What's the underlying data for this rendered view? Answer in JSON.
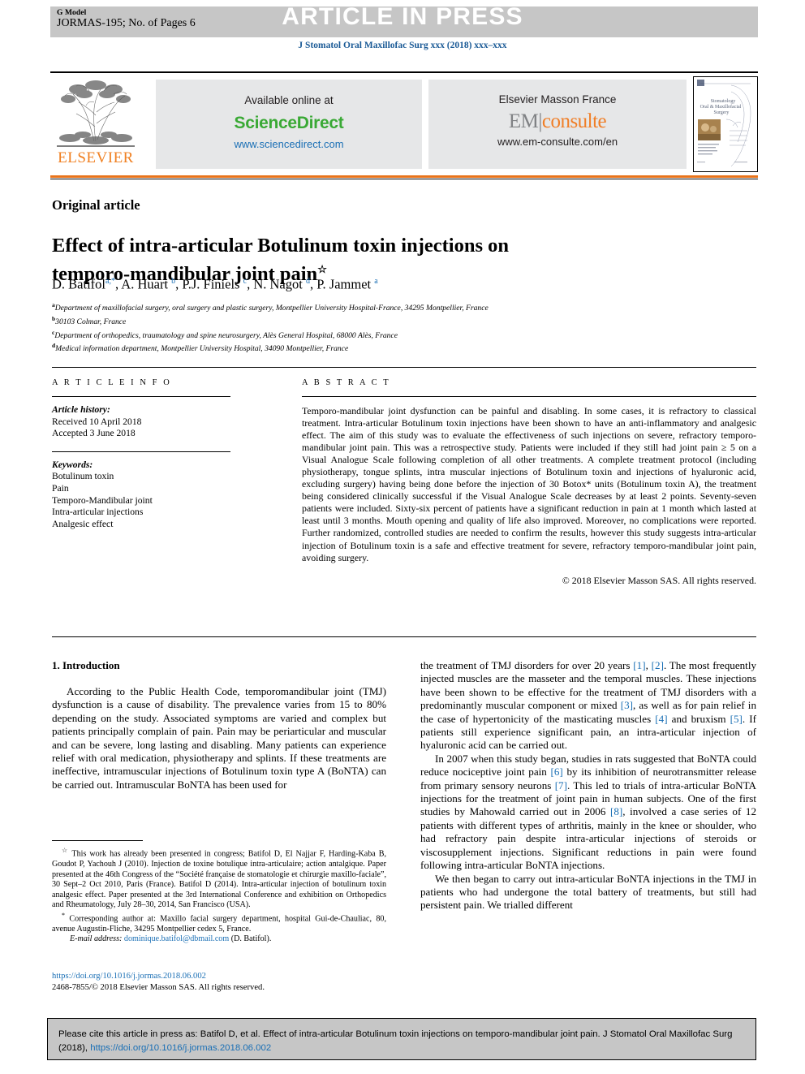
{
  "header": {
    "g_model": "G Model",
    "manuscript_id": "JORMAS-195; No. of Pages 6",
    "banner_text": "ARTICLE IN PRESS",
    "journal_line": "J Stomatol Oral Maxillofac Surg xxx (2018) xxx–xxx"
  },
  "masthead": {
    "elsevier_label": "ELSEVIER",
    "sciencedirect": {
      "available": "Available online at",
      "brand": "ScienceDirect",
      "url": "www.sciencedirect.com"
    },
    "emconsulte": {
      "publisher": "Elsevier Masson France",
      "brand_left": "EM",
      "brand_bar": "|",
      "brand_right": "consulte",
      "url": "www.em-consulte.com/en"
    },
    "cover": {
      "line1": "Stomatology",
      "line2": "Oral & Maxillofacial",
      "line3": "Surgery"
    }
  },
  "article": {
    "type": "Original article",
    "title": "Effect of intra-articular Botulinum toxin injections on temporo-mandibular joint pain",
    "title_footnote_mark": "☆",
    "authors_html": "D. Batifol<sup>a,*</sup>, A. Huart <sup>b</sup>, P.J. Finiels <sup>c</sup>, N. Nagot <sup>d</sup>, P. Jammet <sup>a</sup>",
    "affiliations": [
      {
        "mark": "a",
        "text": "Department of maxillofacial surgery, oral surgery and plastic surgery, Montpellier University Hospital-France, 34295 Montpellier, France"
      },
      {
        "mark": "b",
        "text": "30103 Colmar, France"
      },
      {
        "mark": "c",
        "text": "Department of orthopedics, traumatology and spine neurosurgery, Alès General Hospital, 68000 Alès, France"
      },
      {
        "mark": "d",
        "text": "Medical information department, Montpellier University Hospital, 34090 Montpellier, France"
      }
    ]
  },
  "article_info": {
    "heading": "A R T I C L E   I N F O",
    "history_label": "Article history:",
    "received": "Received 10 April 2018",
    "accepted": "Accepted 3 June 2018",
    "keywords_label": "Keywords:",
    "keywords": [
      "Botulinum toxin",
      "Pain",
      "Temporo-Mandibular joint",
      "Intra-articular injections",
      "Analgesic effect"
    ]
  },
  "abstract": {
    "heading": "A B S T R A C T",
    "body": "Temporo-mandibular joint dysfunction can be painful and disabling. In some cases, it is refractory to classical treatment. Intra-articular Botulinum toxin injections have been shown to have an anti-inflammatory and analgesic effect. The aim of this study was to evaluate the effectiveness of such injections on severe, refractory temporo-mandibular joint pain. This was a retrospective study. Patients were included if they still had joint pain ≥ 5 on a Visual Analogue Scale following completion of all other treatments. A complete treatment protocol (including physiotherapy, tongue splints, intra muscular injections of Botulinum toxin and injections of hyaluronic acid, excluding surgery) having being done before the injection of 30 Botox* units (Botulinum toxin A), the treatment being considered clinically successful if the Visual Analogue Scale decreases by at least 2 points. Seventy-seven patients were included. Sixty-six percent of patients have a significant reduction in pain at 1 month which lasted at least until 3 months. Mouth opening and quality of life also improved. Moreover, no complications were reported. Further randomized, controlled studies are needed to confirm the results, however this study suggests intra-articular injection of Botulinum toxin is a safe and effective treatment for severe, refractory temporo-mandibular joint pain, avoiding surgery.",
    "copyright": "© 2018 Elsevier Masson SAS. All rights reserved."
  },
  "introduction": {
    "heading": "1. Introduction",
    "left_paragraph": "According to the Public Health Code, temporomandibular joint (TMJ) dysfunction is a cause of disability. The prevalence varies from 15 to 80% depending on the study. Associated symptoms are varied and complex but patients principally complain of pain. Pain may be periarticular and muscular and can be severe, long lasting and disabling. Many patients can experience relief with oral medication, physiotherapy and splints. If these treatments are ineffective, intramuscular injections of Botulinum toxin type A (BoNTA) can be carried out. Intramuscular BoNTA has been used for",
    "right_paragraph_1_a": "the treatment of TMJ disorders for over 20 years ",
    "right_p1_ref1": "[1]",
    "right_p1_mid": ", ",
    "right_p1_ref2": "[2]",
    "right_paragraph_1_b": ". The most frequently injected muscles are the masseter and the temporal muscles. These injections have been shown to be effective for the treatment of TMJ disorders with a predominantly muscular component or mixed ",
    "right_p1_ref3": "[3]",
    "right_paragraph_1_c": ", as well as for pain relief in the case of hypertonicity of the masticating muscles ",
    "right_p1_ref4": "[4]",
    "right_paragraph_1_d": " and bruxism ",
    "right_p1_ref5": "[5]",
    "right_paragraph_1_e": ". If patients still experience significant pain, an intra-articular injection of hyaluronic acid can be carried out.",
    "right_paragraph_2_a": "In 2007 when this study began, studies in rats suggested that BoNTA could reduce nociceptive joint pain ",
    "right_p2_ref6": "[6]",
    "right_paragraph_2_b": " by its inhibition of neurotransmitter release from primary sensory neurons ",
    "right_p2_ref7": "[7]",
    "right_paragraph_2_c": ". This led to trials of intra-articular BoNTA injections for the treatment of joint pain in human subjects. One of the first studies by Mahowald carried out in 2006 ",
    "right_p2_ref8": "[8]",
    "right_paragraph_2_d": ", involved a case series of 12 patients with different types of arthritis, mainly in the knee or shoulder, who had refractory pain despite intra-articular injections of steroids or viscosupplement injections. Significant reductions in pain were found following intra-articular BoNTA injections.",
    "right_paragraph_3": "We then began to carry out intra-articular BoNTA injections in the TMJ in patients who had undergone the total battery of treatments, but still had persistent pain. We trialled different"
  },
  "footnotes": {
    "star_mark": "☆",
    "star_text": "This work has already been presented in congress; Batifol D, El Najjar F, Harding-Kaba B, Goudot P, Yachouh J (2010). Injection de toxine botulique intra-articulaire; action antalgique. Paper presented at the 46th Congress of the “Société française de stomatologie et chirurgie maxillo-faciale”, 30 Sept–2 Oct 2010, Paris (France). Batifol D (2014). Intra-articular injection of botulinum toxin analgesic effect. Paper presented at the 3rd International Conference and exhibition on Orthopedics and Rheumatology, July 28–30, 2014, San Francisco (USA).",
    "corr_mark": "*",
    "corr_text": "Corresponding author at: Maxillo facial surgery department, hospital Gui-de-Chauliac, 80, avenue Augustin-Fliche, 34295 Montpellier cedex 5, France.",
    "email_label": "E-mail address:",
    "email": "dominique.batifol@dbmail.com",
    "email_suffix": "(D. Batifol)."
  },
  "doi_block": {
    "doi_url": "https://doi.org/10.1016/j.jormas.2018.06.002",
    "issn_line": "2468-7855/© 2018 Elsevier Masson SAS. All rights reserved."
  },
  "cite_box": {
    "text_before": "Please cite this article in press as: Batifol D, et al. Effect of intra-articular Botulinum toxin injections on temporo-mandibular joint pain. J Stomatol Oral Maxillofac Surg (2018), ",
    "doi": "https://doi.org/10.1016/j.jormas.2018.06.002"
  },
  "colors": {
    "banner_grey": "#c6c6c6",
    "panel_grey": "#e6e7e8",
    "link_blue": "#1a6fb5",
    "sciencedirect_green": "#3aa935",
    "elsevier_orange": "#f08022",
    "em_orange": "#f07e26"
  }
}
